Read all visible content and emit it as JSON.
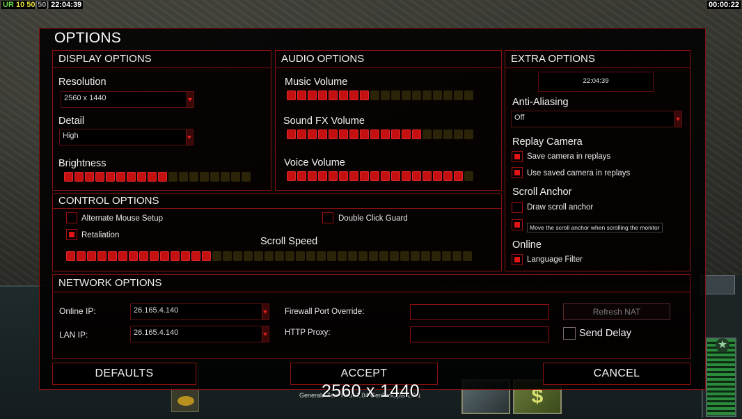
{
  "topbar": {
    "left_label": "UR",
    "left_value1": "10",
    "left_value2": "50",
    "left_bracket_value": "[50]",
    "clock": "22:04:39",
    "right_timer": "00:00:22"
  },
  "dialog": {
    "title": "OPTIONS"
  },
  "display_options": {
    "title": "DISPLAY OPTIONS",
    "resolution_label": "Resolution",
    "resolution_value": "2560 x 1440",
    "detail_label": "Detail",
    "detail_value": "High",
    "brightness_label": "Brightness",
    "brightness_level": 0.55
  },
  "audio_options": {
    "title": "AUDIO OPTIONS",
    "music_label": "Music Volume",
    "music_level": 0.44,
    "sfx_label": "Sound FX Volume",
    "sfx_level": 0.72,
    "voice_label": "Voice Volume",
    "voice_level": 0.97
  },
  "extra_options": {
    "title": "EXTRA OPTIONS",
    "clock_value": "22:04:39",
    "aa_label": "Anti-Aliasing",
    "aa_value": "Off",
    "replay_camera_label": "Replay Camera",
    "save_camera_label": "Save camera in replays",
    "save_camera_checked": true,
    "use_saved_camera_label": "Use saved camera in replays",
    "use_saved_camera_checked": true,
    "scroll_anchor_label": "Scroll Anchor",
    "draw_scroll_anchor_label": "Draw scroll anchor",
    "draw_scroll_anchor_checked": false,
    "move_scroll_anchor_checked": true,
    "tooltip_text": "Move the scroll anchor when scrolling the monitor",
    "online_label": "Online",
    "language_filter_label": "Language Filter",
    "language_filter_checked": true
  },
  "control_options": {
    "title": "CONTROL OPTIONS",
    "alt_mouse_label": "Alternate Mouse Setup",
    "alt_mouse_checked": false,
    "retaliation_label": "Retaliation",
    "retaliation_checked": true,
    "double_click_label": "Double Click Guard",
    "double_click_checked": false,
    "scroll_speed_label": "Scroll Speed",
    "scroll_speed_level": 0.36
  },
  "network_options": {
    "title": "NETWORK OPTIONS",
    "online_ip_label": "Online IP:",
    "online_ip_value": "26.165.4.140",
    "lan_ip_label": "LAN IP:",
    "lan_ip_value": "26.165.4.140",
    "firewall_label": "Firewall Port Override:",
    "firewall_value": "",
    "http_proxy_label": "HTTP Proxy:",
    "http_proxy_value": "",
    "refresh_nat_label": "Refresh NAT",
    "send_delay_label": "Send Delay",
    "send_delay_checked": false
  },
  "buttons": {
    "defaults": "DEFAULTS",
    "accept": "ACCEPT",
    "cancel": "CANCEL"
  },
  "overlay": {
    "resolution_text": "2560 x 1440",
    "version_text": "Generals Zero Hour 1.04 GenProOpts 1.0.1"
  },
  "hud": {
    "card_icon": "$"
  },
  "colors": {
    "accent_red": "#c41010",
    "border_red": "#8a1010",
    "slider_off": "#2c2408"
  }
}
